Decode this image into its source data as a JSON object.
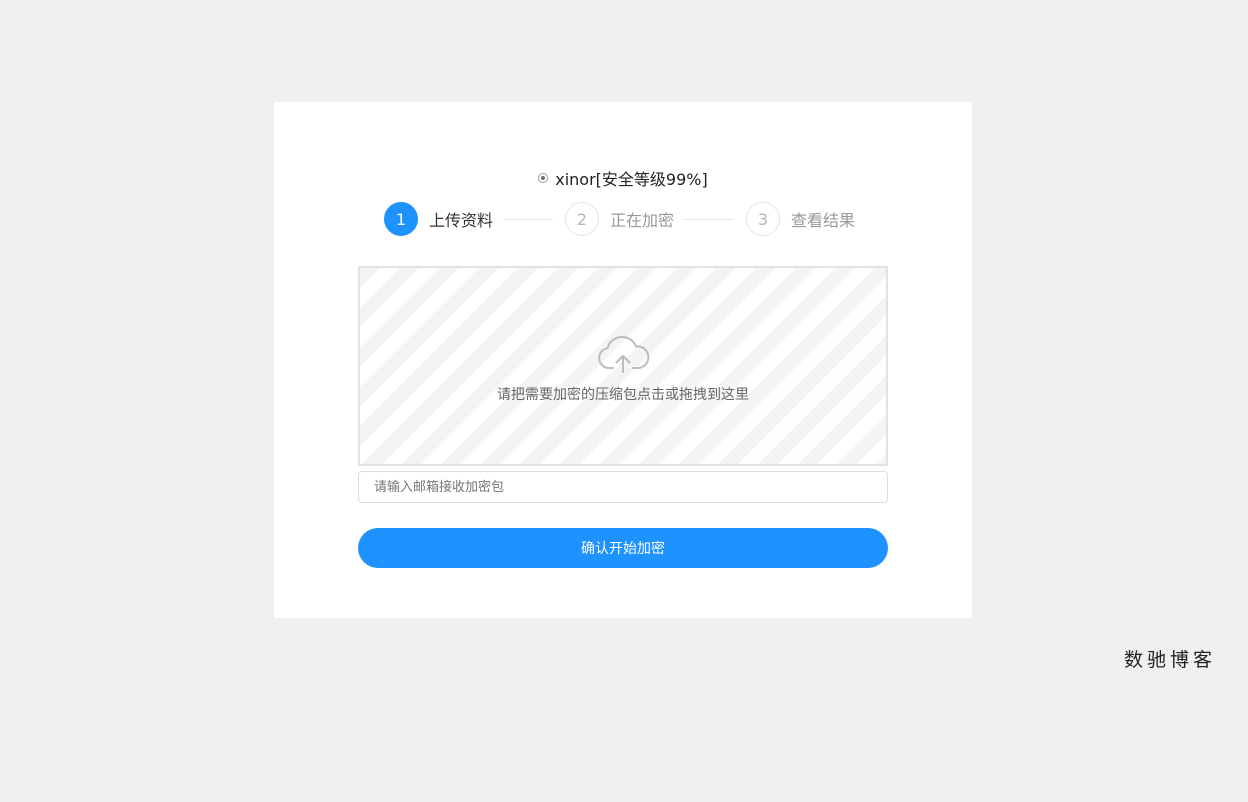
{
  "encryption": {
    "option_label": "xinor[安全等级99%]"
  },
  "steps": [
    {
      "number": "1",
      "label": "上传资料",
      "active": true
    },
    {
      "number": "2",
      "label": "正在加密",
      "active": false
    },
    {
      "number": "3",
      "label": "查看结果",
      "active": false
    }
  ],
  "upload": {
    "icon": "cloud-upload-icon",
    "hint": "请把需要加密的压缩包点击或拖拽到这里"
  },
  "email": {
    "value": "",
    "placeholder": "请输入邮箱接收加密包"
  },
  "submit_label": "确认开始加密",
  "watermark": "数驰博客",
  "colors": {
    "accent": "#1e93ff",
    "background": "#f0f0f0"
  }
}
